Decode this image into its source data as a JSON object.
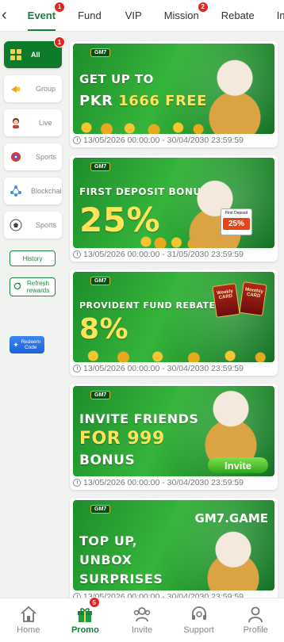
{
  "topbar": {
    "back_icon": "chevron-left-icon",
    "tabs": [
      {
        "label": "Event",
        "badge": "1",
        "active": true
      },
      {
        "label": "Fund"
      },
      {
        "label": "VIP"
      },
      {
        "label": "Mission",
        "badge": "2"
      },
      {
        "label": "Rebate"
      },
      {
        "label": "In"
      }
    ]
  },
  "sidebar": {
    "categories": [
      {
        "label": "All",
        "icon": "grid-icon",
        "active": true,
        "badge": "1"
      },
      {
        "label": "Group",
        "icon": "megaphone-icon"
      },
      {
        "label": "Live",
        "icon": "live-dealer-icon"
      },
      {
        "label": "Sports",
        "icon": "casino-chip-icon"
      },
      {
        "label": "Blockchai",
        "icon": "blockchain-icon"
      },
      {
        "label": "Sports",
        "icon": "soccer-ball-icon"
      }
    ],
    "history_label": "History",
    "refresh_label": "Refresh rewards",
    "redeem_label": "Redeem Code"
  },
  "promos": [
    {
      "logo": "GM7",
      "line1": "GET UP TO",
      "line2a": "PKR ",
      "line2b": "1666 FREE",
      "date": "13/05/2026 00:00:00 - 30/04/2030 23:59:59"
    },
    {
      "logo": "GM7",
      "line1": "FIRST DEPOSIT BONUS",
      "line2": "25%",
      "tag_title": "First Deposit",
      "tag_value": "25%",
      "date": "13/05/2026 00:00:00 - 31/05/2030 23:59:59"
    },
    {
      "logo": "GM7",
      "line1": "PROVIDENT FUND REBATE",
      "line2": "8%",
      "card1": "Weekly CARD",
      "card2": "Monthly CARD",
      "date": "13/05/2026 00:00:00 - 30/04/2030 23:59:59"
    },
    {
      "logo": "GM7",
      "line1": "INVITE FRIENDS",
      "line2": "FOR 999",
      "line3": "BONUS",
      "button": "Invite",
      "date": "13/05/2026 00:00:00 - 30/04/2030 23:59:59"
    },
    {
      "logo": "GM7",
      "line1": "TOP UP,",
      "line2": "UNBOX",
      "line3": "SURPRISES",
      "brand": "GM7.GAME",
      "date": "13/05/2026 00:00:00 - 30/04/2030 23:59:59"
    }
  ],
  "bottom_nav": [
    {
      "label": "Home",
      "icon": "home-icon"
    },
    {
      "label": "Promo",
      "icon": "gift-icon",
      "badge": "5",
      "active": true
    },
    {
      "label": "Invite",
      "icon": "invite-icon"
    },
    {
      "label": "Support",
      "icon": "headset-icon"
    },
    {
      "label": "Profile",
      "icon": "profile-icon"
    }
  ],
  "colors": {
    "primary": "#14803c",
    "badge": "#e02323",
    "banner_green": "#2ea335",
    "accent_yellow": "#ffe35a"
  }
}
